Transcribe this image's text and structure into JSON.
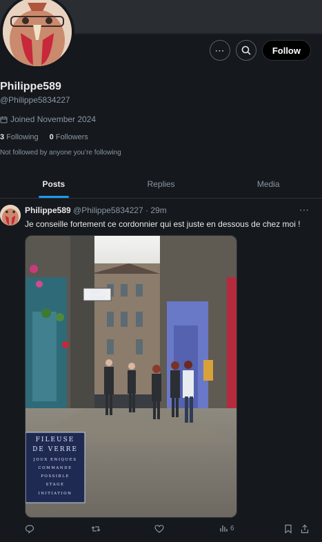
{
  "profile": {
    "display_name": "Philippe589",
    "handle": "@Philippe5834227",
    "joined": "Joined November 2024",
    "following_count": "3",
    "following_label": "Following",
    "followers_count": "0",
    "followers_label": "Followers",
    "not_followed_text": "Not followed by anyone you’re following"
  },
  "actions": {
    "more_icon": "more-icon",
    "search_icon": "search-icon",
    "follow_label": "Follow"
  },
  "tabs": [
    {
      "label": "Posts",
      "active": true
    },
    {
      "label": "Replies",
      "active": false
    },
    {
      "label": "Media",
      "active": false
    }
  ],
  "post": {
    "author": "Philippe589",
    "handle": "@Philippe5834227",
    "separator": "·",
    "time": "29m",
    "text": "Je conseille fortement ce cordonnier qui est juste en dessous de chez moi !",
    "image_sign_shop": [
      "MAG'",
      "OCCAZ"
    ],
    "image_sign_board": [
      "FILEUSE",
      "DE VERRE",
      "JOUX ENIQUES",
      "COMMANDE",
      "POSSIBLE",
      "STAGE",
      "INITIATION"
    ],
    "views": "6"
  },
  "colors": {
    "background": "#15181c",
    "accent": "#1d9bf0",
    "muted_text": "#8b98a5",
    "primary_text": "#e7e9ea"
  }
}
